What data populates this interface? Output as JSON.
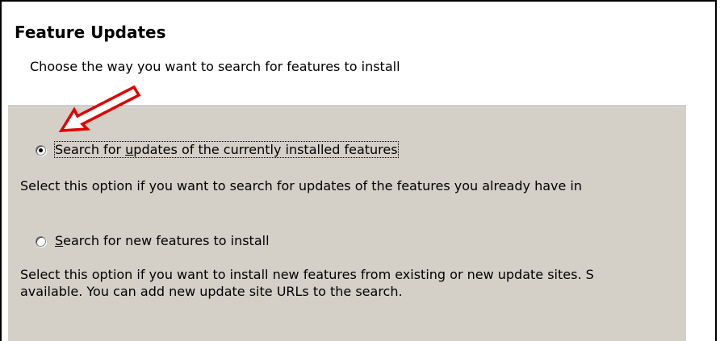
{
  "header": {
    "title": "Feature Updates",
    "description": "Choose the way you want to search for features to install"
  },
  "options": [
    {
      "label_prefix": "Search for ",
      "mnemonic": "u",
      "label_suffix": "pdates of the currently installed features",
      "selected": true,
      "description_lines": [
        "Select this option if you want to search for updates of the features you already have in"
      ]
    },
    {
      "label_prefix": "",
      "mnemonic": "S",
      "label_suffix": "earch for new features to install",
      "selected": false,
      "description_lines": [
        "Select this option if you want to install new features from existing or new update sites. S",
        "available. You can add new update site URLs to the search."
      ]
    }
  ],
  "annotation": {
    "arrow_color": "#e00000",
    "arrow_icon": "red-arrow-icon"
  }
}
